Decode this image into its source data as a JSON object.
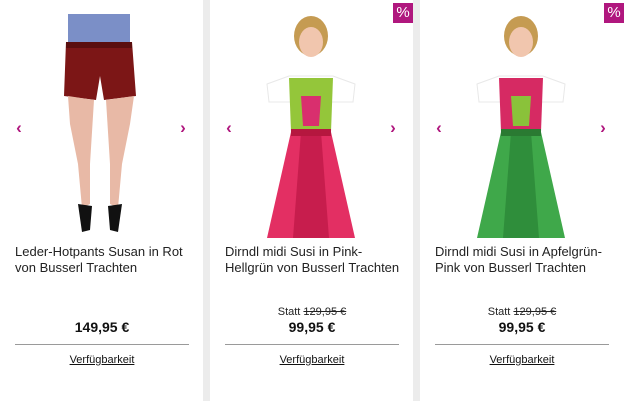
{
  "products": [
    {
      "title": "Leder-Hotpants Susan in Rot von Busserl Trachten",
      "old_price_prefix": "",
      "old_price": "",
      "price": "149,95 €",
      "availability": "Verfügbarkeit",
      "image_alt": "model wearing red leather hotpants",
      "sale_badge": ""
    },
    {
      "title": "Dirndl midi Susi in Pink-Hellgrün von Busserl Trachten",
      "old_price_prefix": "Statt",
      "old_price": "129,95 €",
      "price": "99,95 €",
      "availability": "Verfügbarkeit",
      "image_alt": "model wearing pink and light-green midi dirndl",
      "sale_badge": "%"
    },
    {
      "title": "Dirndl midi Susi in Apfelgrün-Pink von Busserl Trachten",
      "old_price_prefix": "Statt",
      "old_price": "129,95 €",
      "price": "99,95 €",
      "availability": "Verfügbarkeit",
      "image_alt": "model wearing apple-green and pink midi dirndl",
      "sale_badge": "%"
    }
  ],
  "icons": {
    "prev": "chevron-left-icon",
    "next": "chevron-right-icon"
  },
  "colors": {
    "accent": "#b0177e"
  }
}
